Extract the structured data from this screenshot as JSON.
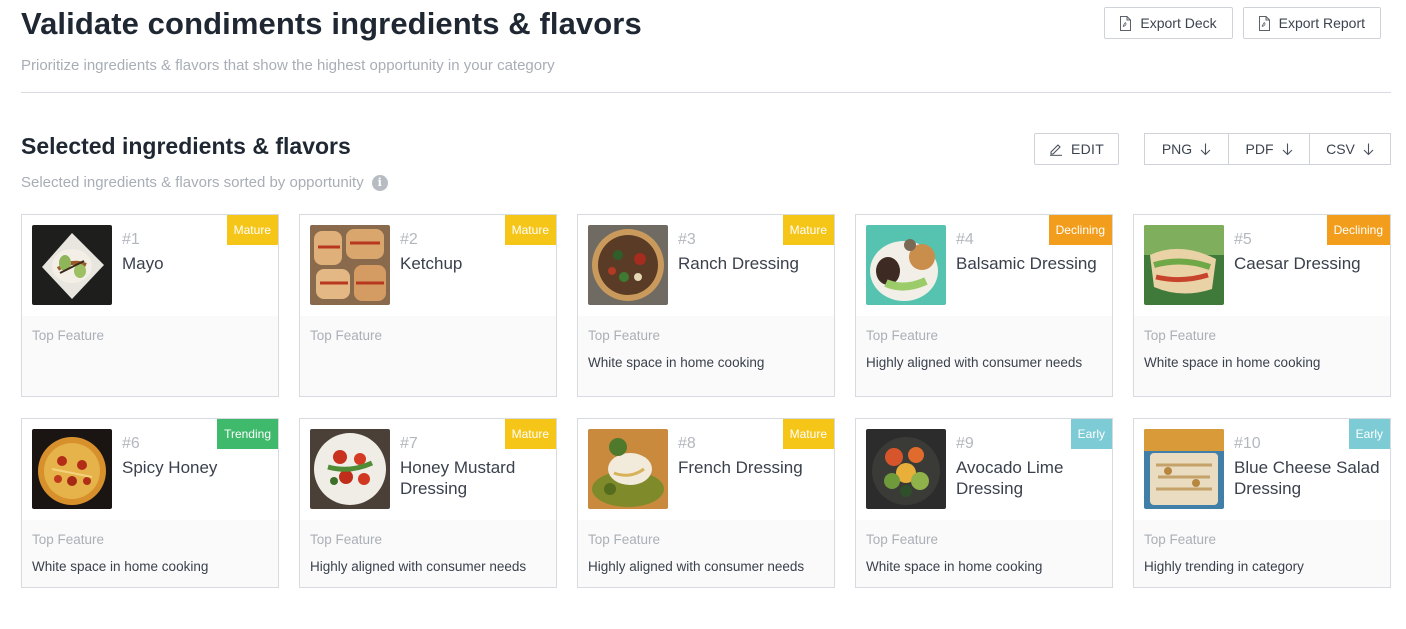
{
  "header": {
    "title": "Validate condiments ingredients & flavors",
    "subtitle": "Prioritize ingredients & flavors that show the highest opportunity in your category",
    "export_deck_label": "Export Deck",
    "export_report_label": "Export Report",
    "export_icon": "file-icon"
  },
  "section": {
    "title": "Selected ingredients & flavors",
    "subtitle": "Selected ingredients & flavors sorted by opportunity",
    "info_icon": "info-icon",
    "edit_label": "EDIT",
    "png_label": "PNG",
    "pdf_label": "PDF",
    "csv_label": "CSV"
  },
  "colors": {
    "mature": "#f5c518",
    "declining": "#f29d1b",
    "trending": "#3fb96b",
    "early": "#7ccbd5"
  },
  "cards": [
    {
      "rank": "#1",
      "name": "Mayo",
      "badge": "Mature",
      "feature_label": "Top Feature",
      "feature": "",
      "image": "mayo-food-image"
    },
    {
      "rank": "#2",
      "name": "Ketchup",
      "badge": "Mature",
      "feature_label": "Top Feature",
      "feature": "",
      "image": "ketchup-food-image"
    },
    {
      "rank": "#3",
      "name": "Ranch Dressing",
      "badge": "Mature",
      "feature_label": "Top Feature",
      "feature": "White space in home cooking",
      "image": "ranch-dressing-food-image"
    },
    {
      "rank": "#4",
      "name": "Balsamic Dressing",
      "badge": "Declining",
      "feature_label": "Top Feature",
      "feature": "Highly aligned with consumer needs",
      "image": "balsamic-dressing-food-image"
    },
    {
      "rank": "#5",
      "name": "Caesar Dressing",
      "badge": "Declining",
      "feature_label": "Top Feature",
      "feature": "White space in home cooking",
      "image": "caesar-dressing-food-image"
    },
    {
      "rank": "#6",
      "name": "Spicy Honey",
      "badge": "Trending",
      "feature_label": "Top Feature",
      "feature": "White space in home cooking",
      "image": "spicy-honey-food-image"
    },
    {
      "rank": "#7",
      "name": "Honey Mustard Dressing",
      "badge": "Mature",
      "feature_label": "Top Feature",
      "feature": "Highly aligned with consumer needs",
      "image": "honey-mustard-food-image"
    },
    {
      "rank": "#8",
      "name": "French Dressing",
      "badge": "Mature",
      "feature_label": "Top Feature",
      "feature": "Highly aligned with consumer needs",
      "image": "french-dressing-food-image"
    },
    {
      "rank": "#9",
      "name": "Avocado Lime Dressing",
      "badge": "Early",
      "feature_label": "Top Feature",
      "feature": "White space in home cooking",
      "image": "avocado-lime-food-image"
    },
    {
      "rank": "#10",
      "name": "Blue Cheese Salad Dressing",
      "badge": "Early",
      "feature_label": "Top Feature",
      "feature": "Highly trending in category",
      "image": "blue-cheese-food-image"
    }
  ]
}
